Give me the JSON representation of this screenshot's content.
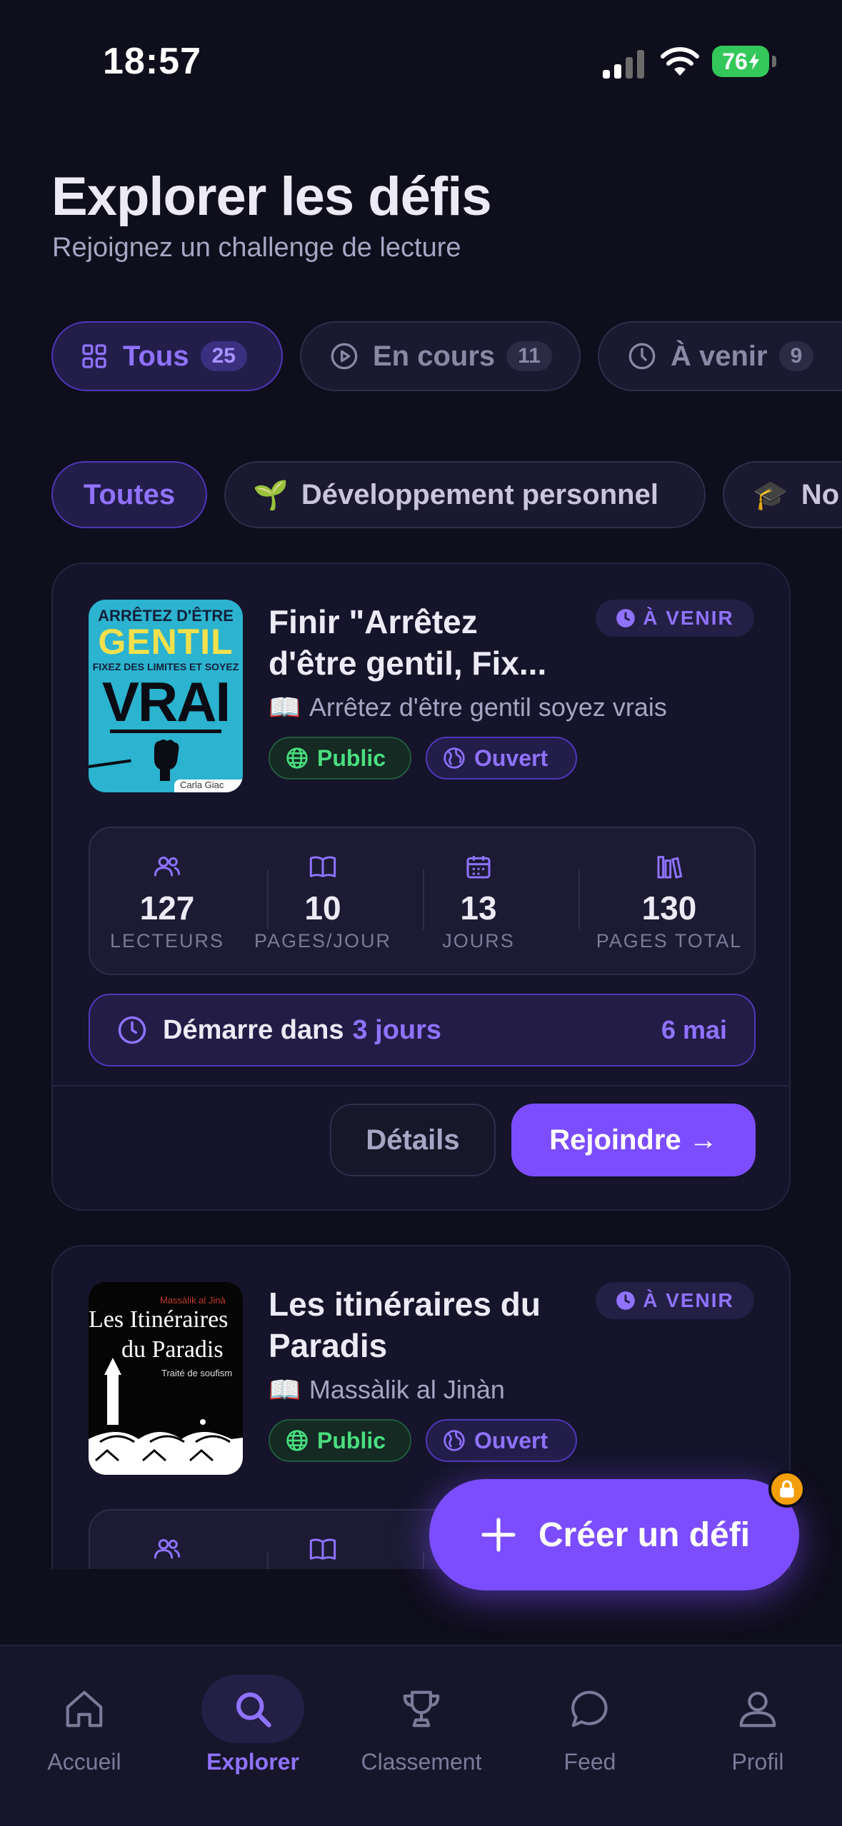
{
  "status_bar": {
    "time": "18:57",
    "battery": "76"
  },
  "header": {
    "title": "Explorer les défis",
    "subtitle": "Rejoignez un challenge de lecture"
  },
  "filters": [
    {
      "label": "Tous",
      "count": "25",
      "icon": "grid-icon",
      "active": true
    },
    {
      "label": "En cours",
      "count": "11",
      "icon": "play-circle-icon",
      "active": false
    },
    {
      "label": "À venir",
      "count": "9",
      "icon": "clock-icon",
      "active": false
    }
  ],
  "categories": [
    {
      "label": "Toutes",
      "emoji": "",
      "active": true
    },
    {
      "label": "Développement personnel",
      "emoji": "🌱",
      "active": false
    },
    {
      "label": "No",
      "emoji": "🎓",
      "active": false
    }
  ],
  "cards": [
    {
      "title_line1": "Finir \"Arrêtez",
      "title_line2": "d'être gentil, Fix...",
      "status_badge": "À VENIR",
      "book_emoji": "📖",
      "book": "Arrêtez d'être gentil soyez vrais",
      "visibility": "Public",
      "access": "Ouvert",
      "cover": {
        "line1": "ARRÊTEZ D'ÊTRE",
        "line2": "GENTIL",
        "line3": "FIXEZ DES LIMITES ET SOYEZ",
        "line4": "VRAI",
        "author": "Carla Giac"
      },
      "stats": [
        {
          "value": "127",
          "label": "LECTEURS",
          "icon": "users-icon"
        },
        {
          "value": "10",
          "label": "PAGES/JOUR",
          "icon": "book-open-icon"
        },
        {
          "value": "13",
          "label": "JOURS",
          "icon": "calendar-icon"
        },
        {
          "value": "130",
          "label": "PAGES TOTAL",
          "icon": "library-icon"
        }
      ],
      "start_prefix": "Démarre dans",
      "start_value": "3 jours",
      "start_date": "6 mai",
      "details_label": "Détails",
      "join_label": "Rejoindre →"
    },
    {
      "title_line1": "Les itinéraires du",
      "title_line2": "Paradis",
      "status_badge": "À VENIR",
      "book_emoji": "📖",
      "book": "Massàlik al Jinàn",
      "visibility": "Public",
      "access": "Ouvert",
      "cover": {
        "top": "Massàlik al Jinà",
        "line1": "Les Itinéraires",
        "line2": "du Paradis",
        "sub": "Traité de soufism"
      }
    }
  ],
  "fab": {
    "label": "Créer un défi"
  },
  "nav": [
    {
      "label": "Accueil",
      "icon": "home-icon"
    },
    {
      "label": "Explorer",
      "icon": "search-icon",
      "active": true
    },
    {
      "label": "Classement",
      "icon": "trophy-icon"
    },
    {
      "label": "Feed",
      "icon": "chat-bubble-icon"
    },
    {
      "label": "Profil",
      "icon": "user-icon"
    }
  ],
  "colors": {
    "accent": "#7c4dff",
    "background": "#0f0e1c",
    "public_green": "#4ade80"
  }
}
